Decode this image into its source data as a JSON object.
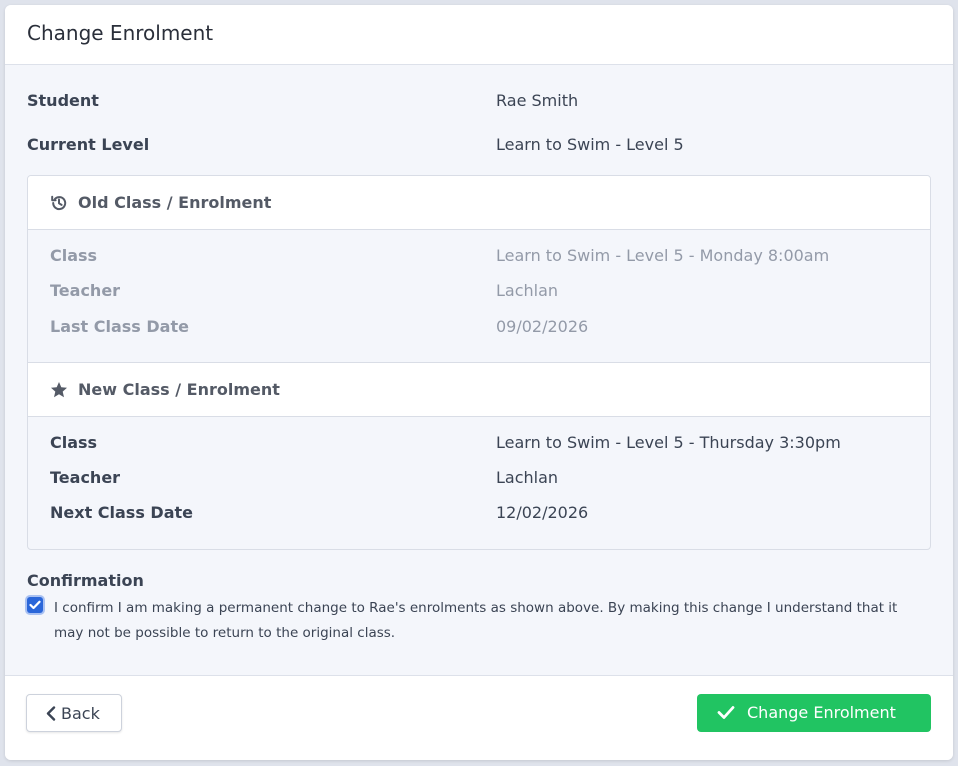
{
  "modal": {
    "title": "Change Enrolment"
  },
  "summary": {
    "student_label": "Student",
    "student_value": "Rae Smith",
    "level_label": "Current Level",
    "level_value": "Learn to Swim - Level 5"
  },
  "old_enrolment": {
    "heading": "Old Class / Enrolment",
    "icon": "history-icon",
    "class_label": "Class",
    "class_value": "Learn to Swim - Level 5 - Monday 8:00am",
    "teacher_label": "Teacher",
    "teacher_value": "Lachlan",
    "date_label": "Last Class Date",
    "date_value": "09/02/2026"
  },
  "new_enrolment": {
    "heading": "New Class / Enrolment",
    "icon": "star-icon",
    "class_label": "Class",
    "class_value": "Learn to Swim - Level 5 - Thursday 3:30pm",
    "teacher_label": "Teacher",
    "teacher_value": "Lachlan",
    "date_label": "Next Class Date",
    "date_value": "12/02/2026"
  },
  "confirmation": {
    "title": "Confirmation",
    "checked": true,
    "text": "I confirm I am making a permanent change to Rae's enrolments as shown above. By making this change I understand that it may not be possible to return to the original class."
  },
  "footer": {
    "back_label": "Back",
    "submit_label": "Change Enrolment"
  },
  "colors": {
    "primary": "#21c462",
    "checkbox": "#2a66d9",
    "muted_text": "#939aa8"
  }
}
